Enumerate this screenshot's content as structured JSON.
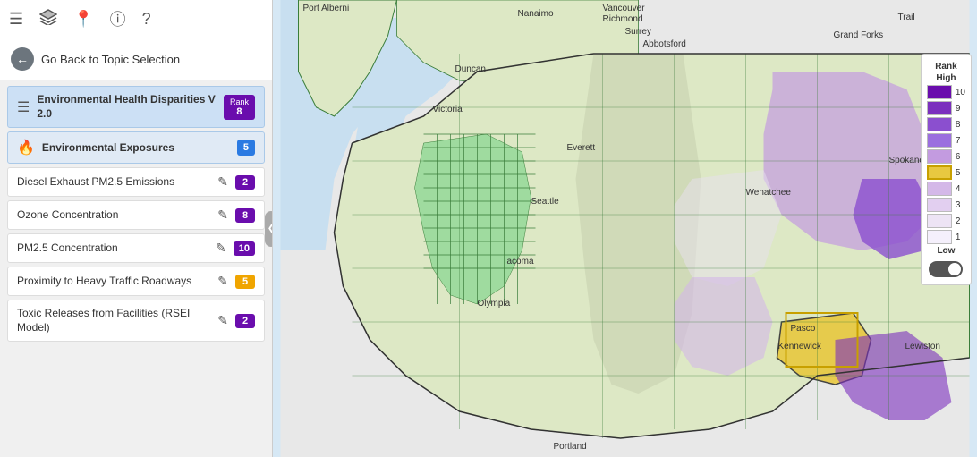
{
  "toolbar": {
    "icons": [
      "list-icon",
      "layers-icon",
      "location-icon",
      "info-icon",
      "help-icon"
    ]
  },
  "back_button": {
    "label": "Go Back to Topic Selection"
  },
  "active_topic": {
    "label": "Environmental Health Disparities V 2.0",
    "rank_label": "Rank",
    "rank_value": "8"
  },
  "secondary_topic": {
    "label": "Environmental Exposures",
    "rank_value": "5"
  },
  "sub_items": [
    {
      "label": "Diesel Exhaust PM2.5 Emissions",
      "rank": "2",
      "rank_type": "purple"
    },
    {
      "label": "Ozone Concentration",
      "rank": "8",
      "rank_type": "purple"
    },
    {
      "label": "PM2.5 Concentration",
      "rank": "10",
      "rank_type": "purple"
    },
    {
      "label": "Proximity to Heavy Traffic Roadways",
      "rank": "5",
      "rank_type": "yellow"
    },
    {
      "label": "Toxic Releases from Facilities (RSEI Model)",
      "rank": "2",
      "rank_type": "purple"
    }
  ],
  "legend": {
    "title": "Rank",
    "high_label": "High",
    "low_label": "Low",
    "rows": [
      {
        "num": "10",
        "color": "#6a0dad"
      },
      {
        "num": "9",
        "color": "#7b2fbe"
      },
      {
        "num": "8",
        "color": "#8b4fcf"
      },
      {
        "num": "7",
        "color": "#9b6fdf"
      },
      {
        "num": "6",
        "color": "#c39be0"
      },
      {
        "num": "5",
        "color": "#e8c840"
      },
      {
        "num": "4",
        "color": "#d4b8e8"
      },
      {
        "num": "3",
        "color": "#e2cff0"
      },
      {
        "num": "2",
        "color": "#ede4f5"
      },
      {
        "num": "1",
        "color": "#f5f0fc"
      }
    ]
  },
  "map": {
    "city_labels": [
      {
        "name": "Port Alberni",
        "x": "25%",
        "y": "1%"
      },
      {
        "name": "Nanaimo",
        "x": "33%",
        "y": "4%"
      },
      {
        "name": "Vancouver",
        "x": "41%",
        "y": "2%"
      },
      {
        "name": "Richmond",
        "x": "42%",
        "y": "4%"
      },
      {
        "name": "Surrey",
        "x": "44%",
        "y": "6%"
      },
      {
        "name": "Abbotsford",
        "x": "47%",
        "y": "8%"
      },
      {
        "name": "Duncan",
        "x": "32%",
        "y": "10%"
      },
      {
        "name": "Victoria",
        "x": "34%",
        "y": "17%"
      },
      {
        "name": "Trail",
        "x": "83%",
        "y": "3%"
      },
      {
        "name": "Grand Forks",
        "x": "77%",
        "y": "6%"
      },
      {
        "name": "Everett",
        "x": "47%",
        "y": "28%"
      },
      {
        "name": "Seattle",
        "x": "46%",
        "y": "38%"
      },
      {
        "name": "Wenatchee",
        "x": "62%",
        "y": "35%"
      },
      {
        "name": "Tacoma",
        "x": "44%",
        "y": "47%"
      },
      {
        "name": "Olympia",
        "x": "40%",
        "y": "53%"
      },
      {
        "name": "Pasco",
        "x": "63%",
        "y": "64%"
      },
      {
        "name": "Kennewick",
        "x": "64%",
        "y": "68%"
      },
      {
        "name": "Spokane",
        "x": "83%",
        "y": "28%"
      },
      {
        "name": "Lewiston",
        "x": "88%",
        "y": "73%"
      },
      {
        "name": "Portland",
        "x": "43%",
        "y": "96%"
      }
    ]
  }
}
